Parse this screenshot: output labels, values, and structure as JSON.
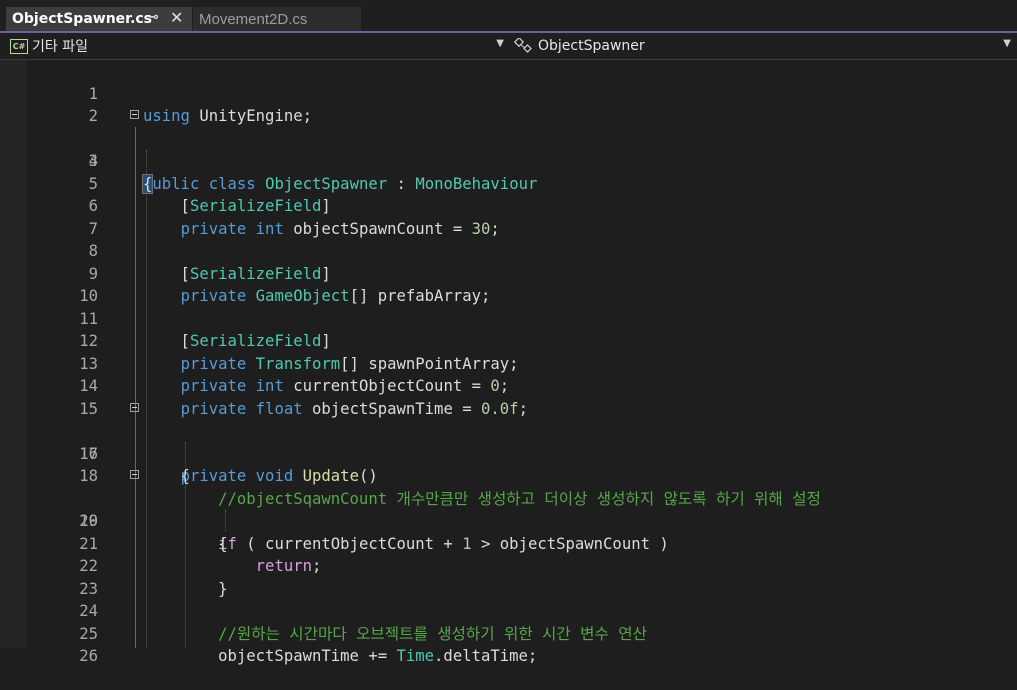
{
  "tabs": [
    {
      "label": "ObjectSpawner.cs",
      "active": true
    },
    {
      "label": "Movement2D.cs",
      "active": false
    }
  ],
  "navbar": {
    "project_label": "기타 파일",
    "project_badge": "C#",
    "class_label": "ObjectSpawner"
  },
  "lines": [
    {
      "n": "1",
      "code": "using UnityEngine;"
    },
    {
      "n": "2",
      "code": ""
    },
    {
      "n": "3",
      "code": "public class ObjectSpawner : MonoBehaviour"
    },
    {
      "n": "4",
      "code": "{"
    },
    {
      "n": "5",
      "code": "    [SerializeField]"
    },
    {
      "n": "6",
      "code": "    private int objectSpawnCount = 30;"
    },
    {
      "n": "7",
      "code": ""
    },
    {
      "n": "8",
      "code": "    [SerializeField]"
    },
    {
      "n": "9",
      "code": "    private GameObject[] prefabArray;"
    },
    {
      "n": "10",
      "code": ""
    },
    {
      "n": "11",
      "code": "    [SerializeField]"
    },
    {
      "n": "12",
      "code": "    private Transform[] spawnPointArray;"
    },
    {
      "n": "13",
      "code": "    private int currentObjectCount = 0;"
    },
    {
      "n": "14",
      "code": "    private float objectSpawnTime = 0.0f;"
    },
    {
      "n": "15",
      "code": ""
    },
    {
      "n": "16",
      "code": "    private void Update()"
    },
    {
      "n": "17",
      "code": "    {"
    },
    {
      "n": "18",
      "code": "        //objectSqawnCount 개수만큼만 생성하고 더이상 생성하지 않도록 하기 위해 설정"
    },
    {
      "n": "19",
      "code": "        if ( currentObjectCount + 1 > objectSpawnCount )"
    },
    {
      "n": "20",
      "code": "        {"
    },
    {
      "n": "21",
      "code": "            return;"
    },
    {
      "n": "22",
      "code": "        }"
    },
    {
      "n": "23",
      "code": ""
    },
    {
      "n": "24",
      "code": "        //원하는 시간마다 오브젝트를 생성하기 위한 시간 변수 연산"
    },
    {
      "n": "25",
      "code": "        objectSpawnTime += Time.deltaTime;"
    },
    {
      "n": "26",
      "code": ""
    }
  ],
  "colors": {
    "keyword": "#569cd6",
    "type": "#4ec9b0",
    "control": "#d8a0df",
    "number": "#b5cea8",
    "comment": "#57a64a",
    "method": "#dcdcaa",
    "text": "#dcdcdc",
    "tab_accent": "#6f5fa8"
  },
  "icons": {
    "pin": "pin-icon",
    "close": "close-icon",
    "project": "csharp-file-icon",
    "class": "class-icon"
  }
}
